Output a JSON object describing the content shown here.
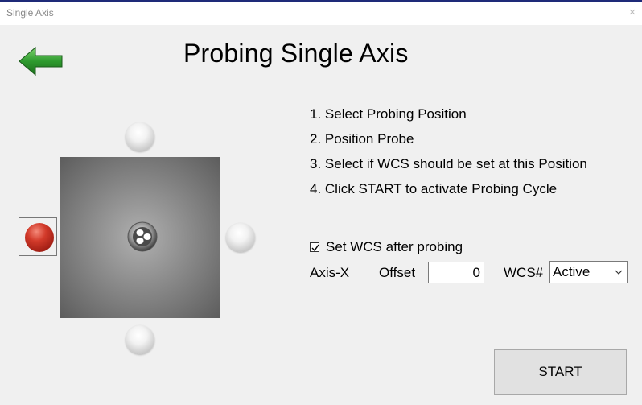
{
  "window": {
    "title": "Single Axis"
  },
  "page": {
    "heading": "Probing Single Axis"
  },
  "steps": [
    "1. Select Probing Position",
    "2. Position Probe",
    "3. Select if WCS should be set at this Position",
    "4. Click START to activate Probing Cycle"
  ],
  "probe_positions": {
    "selected": "left",
    "options": [
      "top",
      "left",
      "right",
      "bottom"
    ]
  },
  "settings": {
    "set_wcs_label": "Set WCS after probing",
    "set_wcs_checked": true,
    "axis_label": "Axis-X",
    "offset_label": "Offset",
    "offset_value": "0",
    "wcs_label": "WCS#",
    "wcs_value": "Active"
  },
  "actions": {
    "start_label": "START"
  },
  "colors": {
    "back_arrow": "#2e9a2e",
    "selected_ball": "#c0281c",
    "workpiece": "#7a7a7a"
  }
}
